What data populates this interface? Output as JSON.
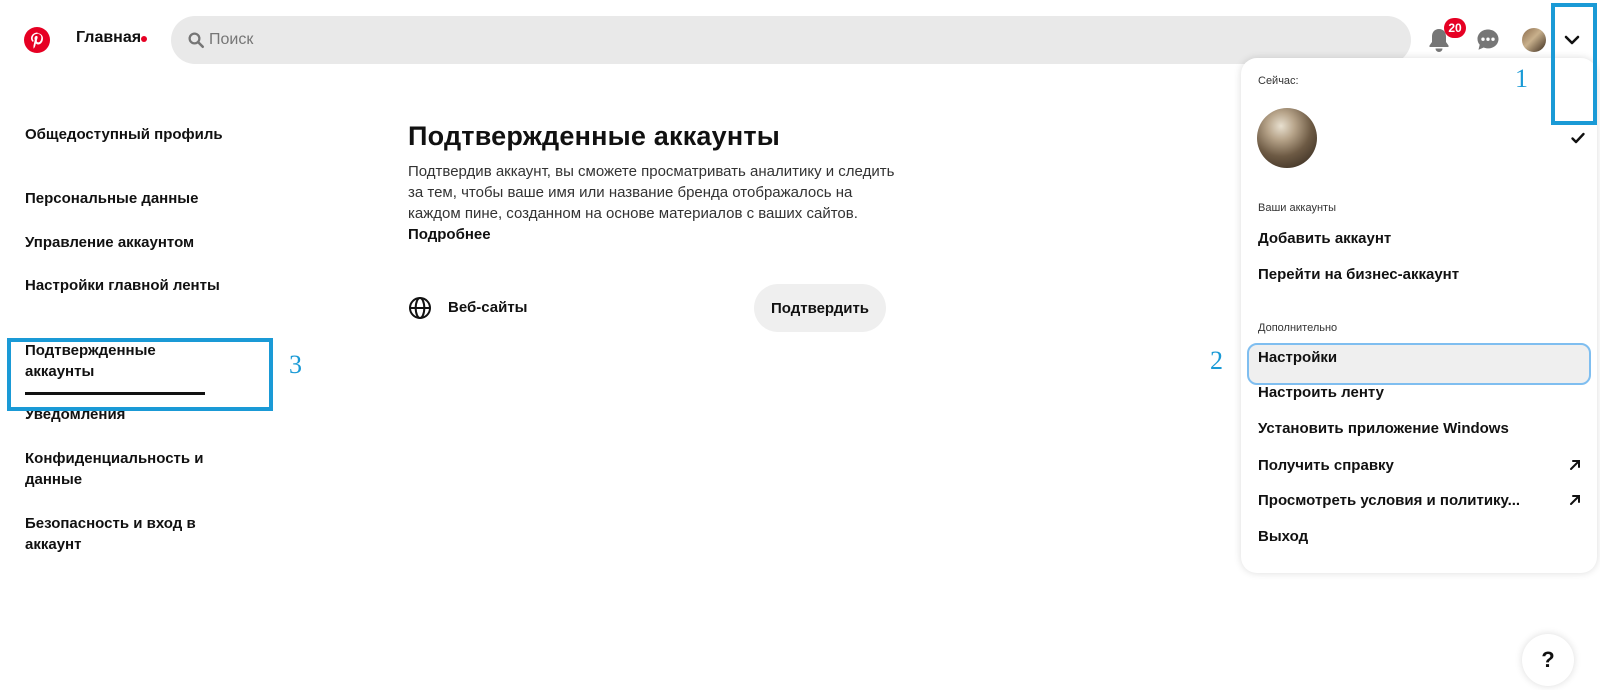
{
  "header": {
    "home_label": "Главная",
    "search_placeholder": "Поиск",
    "notifications_count": "20",
    "icons": [
      "pinterest-logo",
      "search-icon",
      "bell-icon",
      "chat-icon",
      "avatar",
      "chevron-down-icon"
    ]
  },
  "sidebar": {
    "items": [
      {
        "label": "Общедоступный профиль"
      },
      {
        "label": "Персональные данные"
      },
      {
        "label": "Управление аккаунтом"
      },
      {
        "label": "Настройки главной ленты"
      },
      {
        "label": "Подтвержденные аккаунты",
        "active": true
      },
      {
        "label": "Уведомления"
      },
      {
        "label": "Конфиденциальность и данные"
      },
      {
        "label": "Безопасность и вход в аккаунт"
      }
    ]
  },
  "main": {
    "title": "Подтвержденные аккаунты",
    "description": "Подтвердив аккаунт, вы сможете просматривать аналитику и следить за тем, чтобы ваше имя или название бренда отображалось на каждом пине, созданном на основе материалов с ваших сайтов.",
    "more_link": "Подробнее",
    "websites_label": "Веб-сайты",
    "confirm_button": "Подтвердить"
  },
  "dropdown": {
    "current_label": "Сейчас:",
    "accounts_label": "Ваши аккаунты",
    "add_account": "Добавить аккаунт",
    "business_account": "Перейти на бизнес-аккаунт",
    "more_label": "Дополнительно",
    "settings": "Настройки",
    "customize_feed": "Настроить ленту",
    "install_app": "Установить приложение Windows",
    "get_help": "Получить справку",
    "terms": "Просмотреть условия и политику...",
    "logout": "Выход"
  },
  "annotations": {
    "one": "1",
    "two": "2",
    "three": "3",
    "color": "#1a9ad6"
  },
  "help_button": "?",
  "colors": {
    "brand": "#e60023",
    "search_bg": "#e9e9e9",
    "button_bg": "#efefef"
  }
}
